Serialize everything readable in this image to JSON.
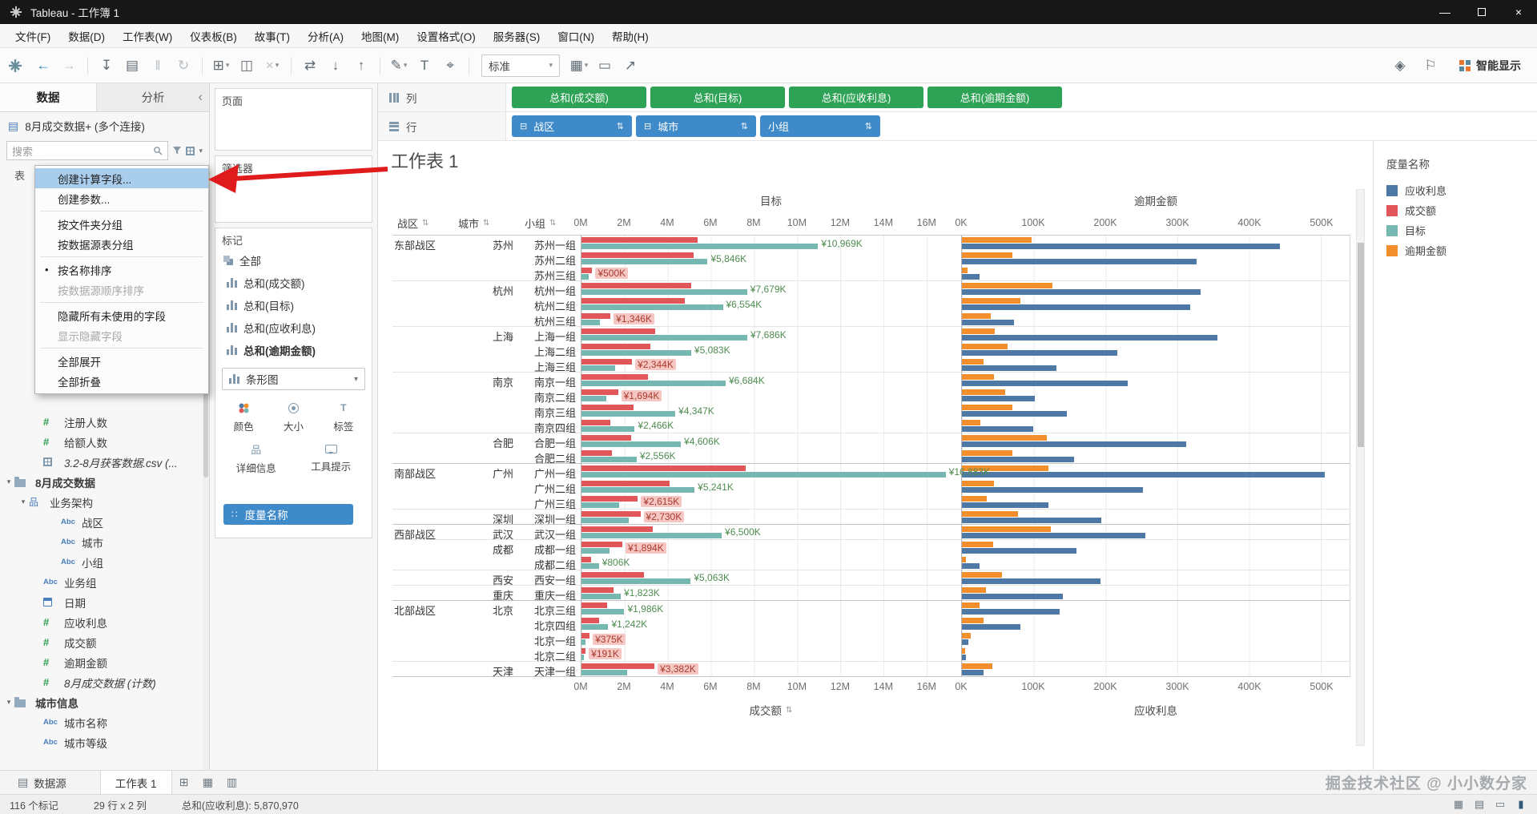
{
  "window": {
    "title": "Tableau - 工作簿 1",
    "controls": {
      "minimize": "—",
      "close": "×"
    }
  },
  "menu_bar": {
    "items": [
      "文件(F)",
      "数据(D)",
      "工作表(W)",
      "仪表板(B)",
      "故事(T)",
      "分析(A)",
      "地图(M)",
      "设置格式(O)",
      "服务器(S)",
      "窗口(N)",
      "帮助(H)"
    ]
  },
  "toolbar": {
    "fit_mode": "标准",
    "show_me_label": "智能显示",
    "buttons": [
      {
        "name": "undo-icon",
        "glyph": "←",
        "accent": true
      },
      {
        "name": "redo-icon",
        "glyph": "→",
        "muted": true
      },
      {
        "type": "divider"
      },
      {
        "name": "save-icon",
        "glyph": "↧"
      },
      {
        "name": "new-datasource-icon",
        "glyph": "▤"
      },
      {
        "name": "pause-updates-icon",
        "glyph": "‖",
        "muted": true
      },
      {
        "name": "run-update-icon",
        "glyph": "↻",
        "muted": true
      },
      {
        "type": "divider"
      },
      {
        "name": "new-worksheet-icon",
        "glyph": "⊞",
        "caret": true
      },
      {
        "name": "duplicate-icon",
        "glyph": "◫"
      },
      {
        "name": "clear-sheet-icon",
        "glyph": "×",
        "caret": true,
        "muted": true
      },
      {
        "type": "divider"
      },
      {
        "name": "swap-axes-icon",
        "glyph": "⇄"
      },
      {
        "name": "sort-ascending-icon",
        "glyph": "↓"
      },
      {
        "name": "sort-descending-icon",
        "glyph": "↑"
      },
      {
        "type": "divider"
      },
      {
        "name": "highlight-icon",
        "glyph": "✎",
        "caret": true
      },
      {
        "name": "text-label-icon",
        "glyph": "T"
      },
      {
        "name": "pin-icon",
        "glyph": "⌖"
      },
      {
        "type": "divider"
      },
      {
        "type": "fit"
      },
      {
        "name": "show-cards-icon",
        "glyph": "▦",
        "caret": true
      },
      {
        "name": "presentation-icon",
        "glyph": "▭"
      },
      {
        "name": "share-icon",
        "glyph": "↗"
      }
    ],
    "right_buttons": [
      {
        "name": "data-guide-icon",
        "glyph": "◈"
      },
      {
        "name": "flag-icon",
        "glyph": "⚐"
      }
    ]
  },
  "data_pane": {
    "tabs": [
      "数据",
      "分析"
    ],
    "collapse_icon": "‹",
    "datasource": "8月成交数据+ (多个连接)",
    "search_placeholder": "搜索",
    "section_label": "表",
    "fields": [
      {
        "icon": "number",
        "label": "注册人数",
        "indent": 2
      },
      {
        "icon": "number",
        "label": "给额人数",
        "indent": 2
      },
      {
        "icon": "table",
        "label": "3.2-8月获客数据.csv (...",
        "indent": 2,
        "italic": true
      },
      {
        "icon": "folder",
        "label": "8月成交数据",
        "indent": 0,
        "caret": "▾",
        "bold": true
      },
      {
        "icon": "hierarchy",
        "label": "业务架构",
        "indent": 1,
        "caret": "▾"
      },
      {
        "icon": "abc",
        "label": "战区",
        "indent": 3
      },
      {
        "icon": "abc",
        "label": "城市",
        "indent": 3
      },
      {
        "icon": "abc",
        "label": "小组",
        "indent": 3
      },
      {
        "icon": "abc",
        "label": "业务组",
        "indent": 2
      },
      {
        "icon": "calendar",
        "label": "日期",
        "indent": 2
      },
      {
        "icon": "number",
        "label": "应收利息",
        "indent": 2
      },
      {
        "icon": "number",
        "label": "成交额",
        "indent": 2
      },
      {
        "icon": "number",
        "label": "逾期金额",
        "indent": 2
      },
      {
        "icon": "number",
        "label": "8月成交数据 (计数)",
        "indent": 2,
        "italic": true
      },
      {
        "icon": "folder",
        "label": "城市信息",
        "indent": 0,
        "caret": "▾",
        "bold": true
      },
      {
        "icon": "abc",
        "label": "城市名称",
        "indent": 2
      },
      {
        "icon": "abc",
        "label": "城市等级",
        "indent": 2
      }
    ]
  },
  "context_menu": {
    "items": [
      {
        "label": "创建计算字段...",
        "type": "highlight"
      },
      {
        "label": "创建参数..."
      },
      {
        "type": "separator"
      },
      {
        "label": "按文件夹分组"
      },
      {
        "label": "按数据源表分组"
      },
      {
        "type": "separator"
      },
      {
        "label": "按名称排序",
        "bullet": true
      },
      {
        "label": "按数据源顺序排序",
        "type": "disabled"
      },
      {
        "type": "separator"
      },
      {
        "label": "隐藏所有未使用的字段"
      },
      {
        "label": "显示隐藏字段",
        "type": "disabled"
      },
      {
        "type": "separator"
      },
      {
        "label": "全部展开"
      },
      {
        "label": "全部折叠"
      }
    ]
  },
  "cards": {
    "pages": {
      "title": "页面"
    },
    "filters": {
      "title": "筛选器"
    },
    "marks": {
      "title": "标记",
      "measures": [
        {
          "label": "全部",
          "icon": "all"
        },
        {
          "label": "总和(成交额)",
          "icon": "bars"
        },
        {
          "label": "总和(目标)",
          "icon": "bars"
        },
        {
          "label": "总和(应收利息)",
          "icon": "bars"
        },
        {
          "label": "总和(逾期金额)",
          "icon": "bars",
          "bold": true
        }
      ],
      "mark_type": "条形图",
      "buttons": [
        "颜色",
        "大小",
        "标签",
        "详细信息",
        "工具提示"
      ],
      "pill": "度量名称"
    }
  },
  "shelves": {
    "columns": {
      "label": "列",
      "pills": [
        "总和(成交额)",
        "总和(目标)",
        "总和(应收利息)",
        "总和(逾期金额)"
      ]
    },
    "rows": {
      "label": "行",
      "pills": [
        {
          "label": "战区",
          "minus": true
        },
        {
          "label": "城市",
          "minus": true
        },
        {
          "label": "小组",
          "minus": false
        }
      ]
    }
  },
  "sheet": {
    "title": "工作表 1"
  },
  "legend": {
    "title": "度量名称",
    "items": [
      {
        "label": "应收利息",
        "color": "#4e79a7"
      },
      {
        "label": "成交额",
        "color": "#e15759"
      },
      {
        "label": "目标",
        "color": "#76b7b2"
      },
      {
        "label": "逾期金额",
        "color": "#f28e2b"
      }
    ]
  },
  "chart_data": {
    "type": "bar",
    "title": "工作表 1",
    "row_headers": [
      "战区",
      "城市",
      "小组"
    ],
    "measures": {
      "deal": "成交额 (单位 M)",
      "target": "目标 (单位 M)",
      "interest": "应收利息 (单位 K)",
      "overdue": "逾期金额 (单位 K)"
    },
    "colors": {
      "应收利息": "#4e79a7",
      "成交额": "#e15759",
      "目标": "#76b7b2",
      "逾期金额": "#f28e2b"
    },
    "panels": [
      {
        "top_axis_title": "目标",
        "bottom_axis_title": "成交额",
        "unit": "M",
        "max": 17.6,
        "ticks": [
          {
            "v": 0,
            "label": "0M"
          },
          {
            "v": 2,
            "label": "2M"
          },
          {
            "v": 4,
            "label": "4M"
          },
          {
            "v": 6,
            "label": "6M"
          },
          {
            "v": 8,
            "label": "8M"
          },
          {
            "v": 10,
            "label": "10M"
          },
          {
            "v": 12,
            "label": "12M"
          },
          {
            "v": 14,
            "label": "14M"
          },
          {
            "v": 16,
            "label": "16M"
          }
        ]
      },
      {
        "top_axis_title": "逾期金额",
        "bottom_axis_title": "应收利息",
        "unit": "K",
        "max": 540,
        "ticks": [
          {
            "v": 0,
            "label": "0K"
          },
          {
            "v": 100,
            "label": "100K"
          },
          {
            "v": 200,
            "label": "200K"
          },
          {
            "v": 300,
            "label": "300K"
          },
          {
            "v": 400,
            "label": "400K"
          },
          {
            "v": 500,
            "label": "500K"
          }
        ]
      }
    ],
    "rows": [
      {
        "region": "东部战区",
        "city": "苏州",
        "group": "苏州一组",
        "label": "¥10,969K",
        "label_color": "green",
        "deal": 5.4,
        "target": 10.969,
        "overdue": 97,
        "interest": 443
      },
      {
        "region": "东部战区",
        "city": "苏州",
        "group": "苏州二组",
        "label": "¥5,846K",
        "label_color": "green",
        "deal": 5.2,
        "target": 5.846,
        "overdue": 70,
        "interest": 327
      },
      {
        "region": "东部战区",
        "city": "苏州",
        "group": "苏州三组",
        "label": "¥500K",
        "label_color": "red",
        "deal": 0.5,
        "target": 0.32,
        "overdue": 8,
        "interest": 24
      },
      {
        "region": "东部战区",
        "city": "杭州",
        "group": "杭州一组",
        "label": "¥7,679K",
        "label_color": "green",
        "deal": 5.1,
        "target": 7.679,
        "overdue": 126,
        "interest": 333
      },
      {
        "region": "东部战区",
        "city": "杭州",
        "group": "杭州二组",
        "label": "¥6,554K",
        "label_color": "green",
        "deal": 4.8,
        "target": 6.554,
        "overdue": 82,
        "interest": 318
      },
      {
        "region": "东部战区",
        "city": "杭州",
        "group": "杭州三组",
        "label": "¥1,346K",
        "label_color": "red",
        "deal": 1.346,
        "target": 0.85,
        "overdue": 40,
        "interest": 72
      },
      {
        "region": "东部战区",
        "city": "上海",
        "group": "上海一组",
        "label": "¥7,686K",
        "label_color": "green",
        "deal": 3.4,
        "target": 7.686,
        "overdue": 46,
        "interest": 356
      },
      {
        "region": "东部战区",
        "city": "上海",
        "group": "上海二组",
        "label": "¥5,083K",
        "label_color": "green",
        "deal": 3.2,
        "target": 5.083,
        "overdue": 64,
        "interest": 216
      },
      {
        "region": "东部战区",
        "city": "上海",
        "group": "上海三组",
        "label": "¥2,344K",
        "label_color": "red",
        "deal": 2.344,
        "target": 1.55,
        "overdue": 30,
        "interest": 132
      },
      {
        "region": "东部战区",
        "city": "南京",
        "group": "南京一组",
        "label": "¥6,684K",
        "label_color": "green",
        "deal": 3.1,
        "target": 6.684,
        "overdue": 45,
        "interest": 231
      },
      {
        "region": "东部战区",
        "city": "南京",
        "group": "南京二组",
        "label": "¥1,694K",
        "label_color": "red",
        "deal": 1.694,
        "target": 1.15,
        "overdue": 60,
        "interest": 101
      },
      {
        "region": "东部战区",
        "city": "南京",
        "group": "南京三组",
        "label": "¥4,347K",
        "label_color": "green",
        "deal": 2.4,
        "target": 4.347,
        "overdue": 70,
        "interest": 146
      },
      {
        "region": "东部战区",
        "city": "南京",
        "group": "南京四组",
        "label": "¥2,466K",
        "label_color": "green",
        "deal": 1.35,
        "target": 2.466,
        "overdue": 26,
        "interest": 99
      },
      {
        "region": "东部战区",
        "city": "合肥",
        "group": "合肥一组",
        "label": "¥4,606K",
        "label_color": "green",
        "deal": 2.3,
        "target": 4.606,
        "overdue": 118,
        "interest": 312
      },
      {
        "region": "东部战区",
        "city": "合肥",
        "group": "合肥二组",
        "label": "¥2,556K",
        "label_color": "green",
        "deal": 1.4,
        "target": 2.556,
        "overdue": 70,
        "interest": 156
      },
      {
        "region": "南部战区",
        "city": "广州",
        "group": "广州一组",
        "label": "¥16,883K",
        "label_color": "green",
        "deal": 7.6,
        "target": 16.883,
        "overdue": 120,
        "interest": 505
      },
      {
        "region": "南部战区",
        "city": "广州",
        "group": "广州二组",
        "label": "¥5,241K",
        "label_color": "green",
        "deal": 4.1,
        "target": 5.241,
        "overdue": 45,
        "interest": 252
      },
      {
        "region": "南部战区",
        "city": "广州",
        "group": "广州三组",
        "label": "¥2,615K",
        "label_color": "red",
        "deal": 2.615,
        "target": 1.75,
        "overdue": 35,
        "interest": 120
      },
      {
        "region": "南部战区",
        "city": "深圳",
        "group": "深圳一组",
        "label": "¥2,730K",
        "label_color": "red",
        "deal": 2.73,
        "target": 2.2,
        "overdue": 78,
        "interest": 194
      },
      {
        "region": "西部战区",
        "city": "武汉",
        "group": "武汉一组",
        "label": "¥6,500K",
        "label_color": "green",
        "deal": 3.3,
        "target": 6.5,
        "overdue": 124,
        "interest": 256
      },
      {
        "region": "西部战区",
        "city": "成都",
        "group": "成都一组",
        "label": "¥1,894K",
        "label_color": "red",
        "deal": 1.894,
        "target": 1.3,
        "overdue": 44,
        "interest": 160
      },
      {
        "region": "西部战区",
        "city": "成都",
        "group": "成都二组",
        "label": "¥806K",
        "label_color": "green",
        "deal": 0.45,
        "target": 0.806,
        "overdue": 6,
        "interest": 24
      },
      {
        "region": "西部战区",
        "city": "西安",
        "group": "西安一组",
        "label": "¥5,063K",
        "label_color": "green",
        "deal": 2.9,
        "target": 5.063,
        "overdue": 56,
        "interest": 193
      },
      {
        "region": "西部战区",
        "city": "重庆",
        "group": "重庆一组",
        "label": "¥1,823K",
        "label_color": "green",
        "deal": 1.5,
        "target": 1.823,
        "overdue": 34,
        "interest": 141
      },
      {
        "region": "北部战区",
        "city": "北京",
        "group": "北京三组",
        "label": "¥1,986K",
        "label_color": "green",
        "deal": 1.2,
        "target": 1.986,
        "overdue": 24,
        "interest": 136
      },
      {
        "region": "北部战区",
        "city": "北京",
        "group": "北京四组",
        "label": "¥1,242K",
        "label_color": "green",
        "deal": 0.8,
        "target": 1.242,
        "overdue": 30,
        "interest": 82
      },
      {
        "region": "北部战区",
        "city": "北京",
        "group": "北京一组",
        "label": "¥375K",
        "label_color": "red",
        "deal": 0.375,
        "target": 0.2,
        "overdue": 12,
        "interest": 9
      },
      {
        "region": "北部战区",
        "city": "北京",
        "group": "北京二组",
        "label": "¥191K",
        "label_color": "red",
        "deal": 0.191,
        "target": 0.1,
        "overdue": 4,
        "interest": 6
      },
      {
        "region": "北部战区",
        "city": "天津",
        "group": "天津一组",
        "label": "¥3,382K",
        "label_color": "red",
        "deal": 3.382,
        "target": 2.1,
        "overdue": 42,
        "interest": 30
      }
    ]
  },
  "tabs_bar": {
    "datasource": "数据源",
    "sheet_tab": "工作表 1",
    "new_icons": [
      {
        "name": "new-worksheet-tab-icon",
        "glyph": "⊞"
      },
      {
        "name": "new-dashboard-tab-icon",
        "glyph": "▦"
      },
      {
        "name": "new-story-tab-icon",
        "glyph": "▥"
      }
    ]
  },
  "status_bar": {
    "marks": "116 个标记",
    "size": "29 行 x 2 列",
    "aggregate": "总和(应收利息): 5,870,970",
    "icons": [
      {
        "name": "status-grid-icon",
        "glyph": "▦"
      },
      {
        "name": "status-rows-icon",
        "glyph": "▤"
      },
      {
        "name": "status-chart-icon",
        "glyph": "▭"
      },
      {
        "name": "status-presentation-icon",
        "glyph": "▮",
        "dark": true
      }
    ]
  },
  "watermark": "掘金技术社区 @ 小小数分家"
}
